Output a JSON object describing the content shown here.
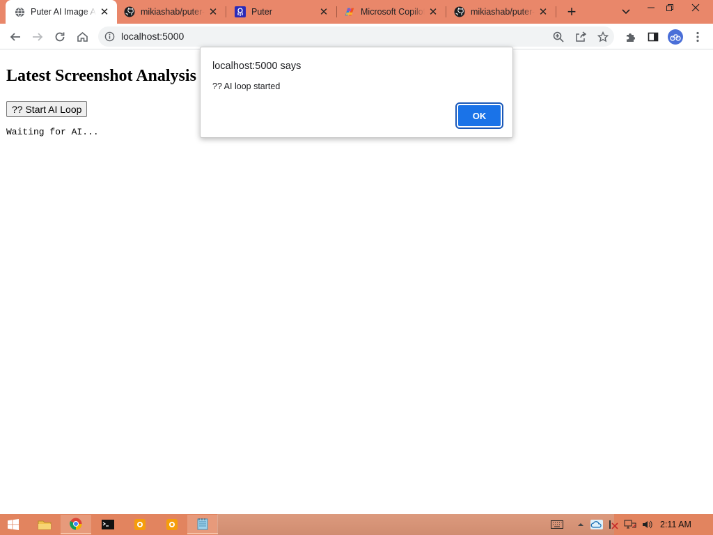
{
  "tabs": [
    {
      "title": "Puter AI Image Analyzer",
      "active": true,
      "icon": "globe-icon"
    },
    {
      "title": "mikiashab/puter-ai",
      "active": false,
      "icon": "github-icon"
    },
    {
      "title": "Puter",
      "active": false,
      "icon": "puter-icon"
    },
    {
      "title": "Microsoft Copilot",
      "active": false,
      "icon": "copilot-icon"
    },
    {
      "title": "mikiashab/puter-ai",
      "active": false,
      "icon": "github-icon"
    }
  ],
  "address_bar": {
    "url": "localhost:5000"
  },
  "page": {
    "heading": "Latest Screenshot Analysis",
    "start_button": "?? Start AI Loop",
    "status": "Waiting for AI..."
  },
  "dialog": {
    "title": "localhost:5000 says",
    "message": "?? AI loop started",
    "ok_label": "OK"
  },
  "taskbar": {
    "clock": "2:11 AM"
  },
  "colors": {
    "tabstrip": "#e9876a",
    "taskbar": "#e2845f",
    "accent": "#1a73e8"
  }
}
